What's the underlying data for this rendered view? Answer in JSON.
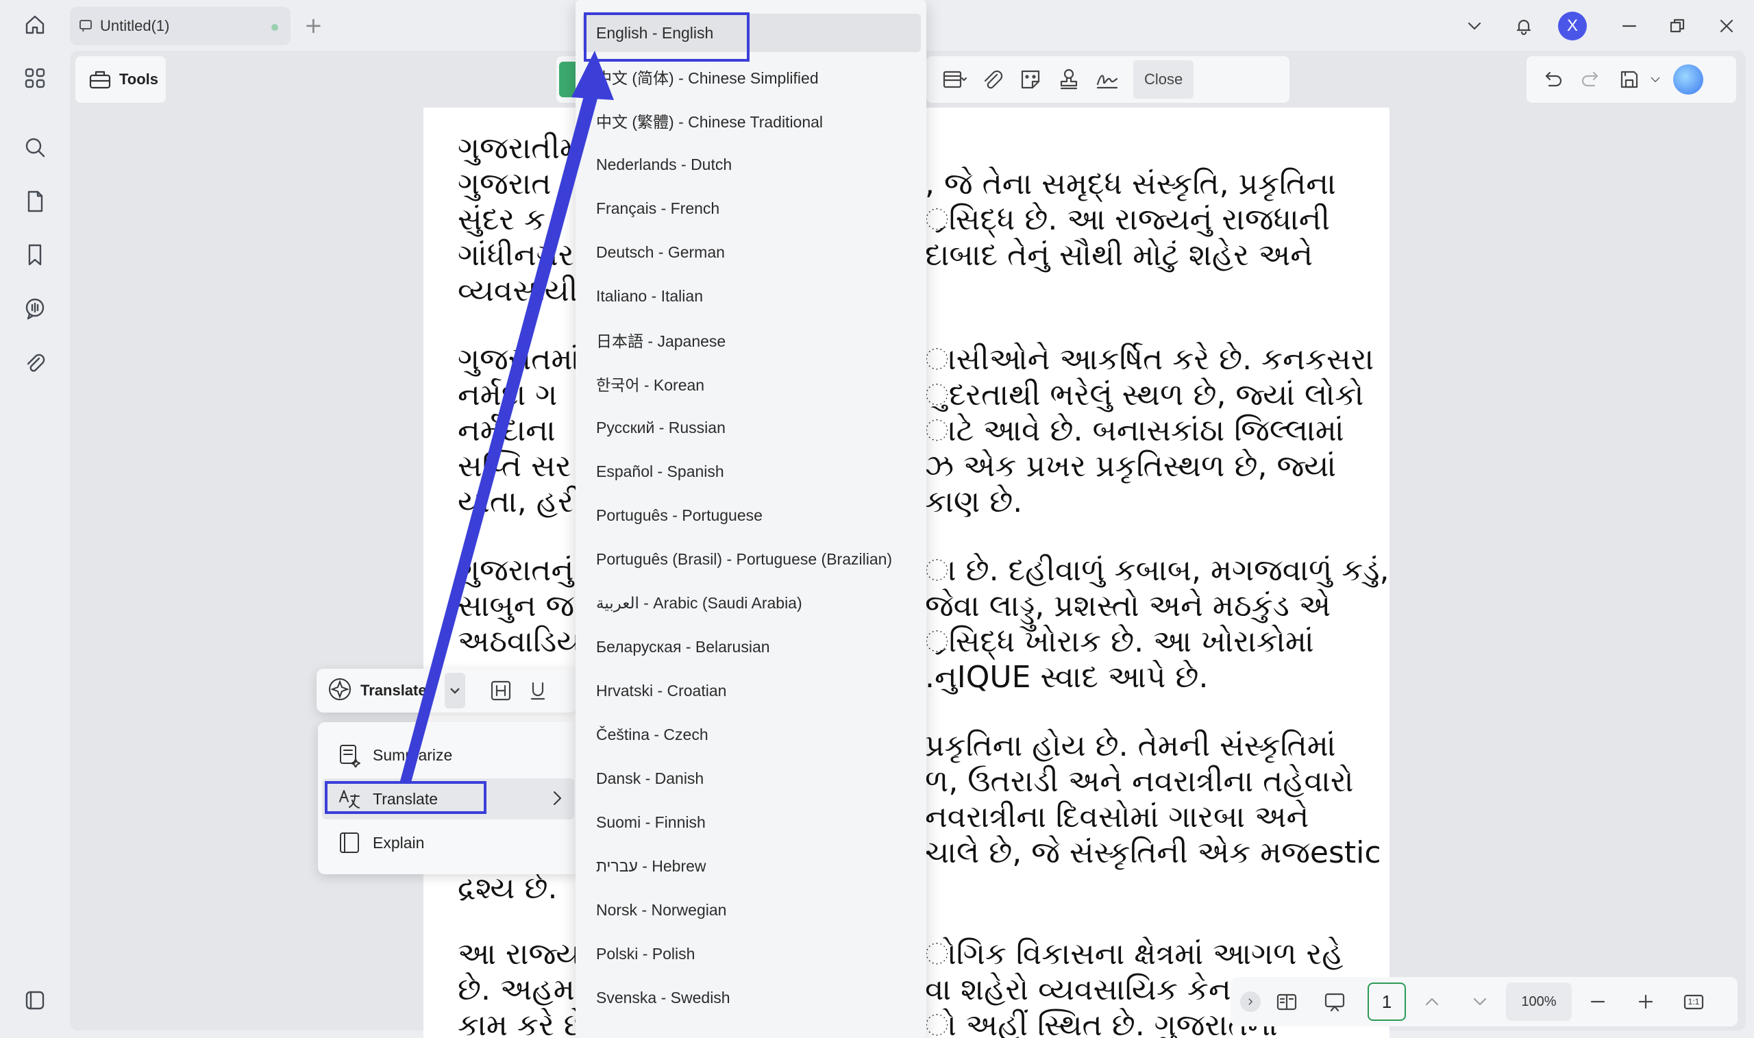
{
  "tab": {
    "title": "Untitled(1)"
  },
  "user": {
    "avatar_letter": "X"
  },
  "toolbar": {
    "tools_label": "Tools",
    "close_label": "Close"
  },
  "document": {
    "paragraphs": [
      [
        "ગુજરાતીમ",
        "ગુજરાત ",
        "સુંદર ક",
        "ગાંધીનગર",
        "વ્યવસાયી"
      ],
      [
        ", જે તેના સમૃદ્ધ સંસ્કૃતિ, પ્રકૃતિના",
        "્રસિદ્ધ છે. આ રાજ્યનું રાજધાની",
        "દાબાદ તેનું સૌથી મોટું શહેર અને",
        ""
      ],
      [
        "ગુજરાતમાં",
        "નર્મદા ગ",
        "નર્મદાના",
        "સપ્તિ સર",
        "યાતા, હરી"
      ],
      [
        "ાસીઓને આકર્ષિત કરે છે. કનકસરા",
        "ુદરતાથી ભરેલું સ્થળ છે, જ્યાં લોકો",
        "ાટે આવે છે. બનાસકાંઠા જિલ્લામાં",
        "ઝ એક પ્રખર પ્રકૃતિસ્થળ છે, જ્યાં",
        "કાણ છે."
      ],
      [
        "ગુજરાતનું",
        "સાબુન જ",
        "અઠવાડિય"
      ],
      [
        "ા છે. દહીવાળું કબાબ, મગજવાળું કડું,",
        "જેવા લાડ્ડુ, પ્રશસ્તો અને મઠકુંડ એ",
        "્રસિદ્ધ ખોરાક છે. આ ખોરાકોમાં",
        ".નુIQUE સ્વાદ આપે છે."
      ],
      [
        "પ્રકૃતિના હોય છે. તેમની સંસ્કૃતિમાં",
        "ળ, ઉતરાડી અને નવરાત્રીના તહેવારો",
        "નવરાત્રીના દિવસોમાં ગારબા અને",
        "ચાલે છે, જે સંસ્કૃતિની એક મજestic"
      ],
      [
        "દ્રશ્ય છે."
      ],
      [
        "આ રાજ્ય",
        "છે. અહમ",
        "કામ કરે છે"
      ],
      [
        "ોગિક વિકાસના ક્ષેત્રમાં આગળ રહે",
        "વા શહેરો વ્યવસાયિક કેન",
        "ો અહીં સ્થિત છે. ગુજરાતના"
      ]
    ]
  },
  "float_toolbar": {
    "translate_label": "Translate"
  },
  "ai_menu": {
    "summarize": "Summarize",
    "translate": "Translate",
    "explain": "Explain"
  },
  "languages": [
    "English - English",
    "中文 (简体) - Chinese Simplified",
    "中文 (繁體) - Chinese Traditional",
    "Nederlands - Dutch",
    "Français - French",
    "Deutsch - German",
    "Italiano - Italian",
    "日本語 - Japanese",
    "한국어 - Korean",
    "Русский - Russian",
    "Español - Spanish",
    "Português - Portuguese",
    "Português (Brasil) - Portuguese (Brazilian)",
    "العربية - Arabic (Saudi Arabia)",
    "Беларуская - Belarusian",
    "Hrvatski - Croatian",
    "Čeština - Czech",
    "Dansk - Danish",
    "Suomi - Finnish",
    "עברית - Hebrew",
    "Norsk - Norwegian",
    "Polski - Polish",
    "Svenska - Swedish"
  ],
  "pagebar": {
    "page": "1",
    "zoom": "100%",
    "fit": "1:1"
  },
  "colors": {
    "highlight": "#3b3fd8",
    "accent_green": "#2a9a55",
    "avatar": "#4a56e8"
  }
}
